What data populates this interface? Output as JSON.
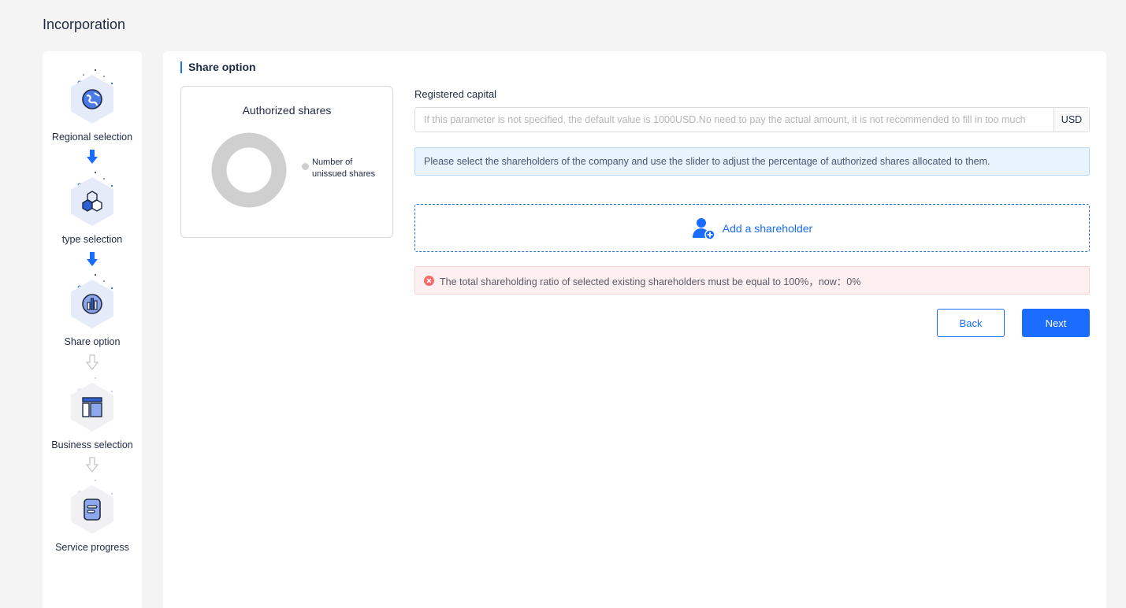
{
  "page": {
    "title": "Incorporation"
  },
  "steps": [
    {
      "label": "Regional selection",
      "state": "done",
      "icon": "globe-icon"
    },
    {
      "label": "type selection",
      "state": "done",
      "icon": "hexagons-icon"
    },
    {
      "label": "Share option",
      "state": "current",
      "icon": "chart-bars-icon"
    },
    {
      "label": "Business selection",
      "state": "pending",
      "icon": "layout-icon"
    },
    {
      "label": "Service progress",
      "state": "pending",
      "icon": "document-icon"
    }
  ],
  "main": {
    "section_title": "Share option",
    "chart": {
      "title": "Authorized shares",
      "legend_label": "Number of unissued shares"
    },
    "registered_capital": {
      "label": "Registered capital",
      "placeholder": "If this parameter is not specified, the default value is 1000USD.No need to pay the actual amount, it is not recommended to fill in too much",
      "suffix": "USD"
    },
    "info_message": "Please select the shareholders of the company and use the slider to adjust the percentage of authorized shares allocated to them.",
    "add_shareholder_label": "Add a shareholder",
    "error_message": "The total shareholding ratio of selected existing shareholders must be equal to 100%，now：0%",
    "buttons": {
      "back": "Back",
      "next": "Next"
    }
  },
  "chart_data": {
    "type": "pie",
    "title": "Authorized shares",
    "categories": [
      "Number of unissued shares"
    ],
    "values": [
      100
    ],
    "legend": "right"
  },
  "colors": {
    "accent": "#1a6dff",
    "error": "#f56c6c",
    "info_bg": "#e8f3fe",
    "error_bg": "#fef0f0",
    "donut": "#cfcfcf"
  }
}
